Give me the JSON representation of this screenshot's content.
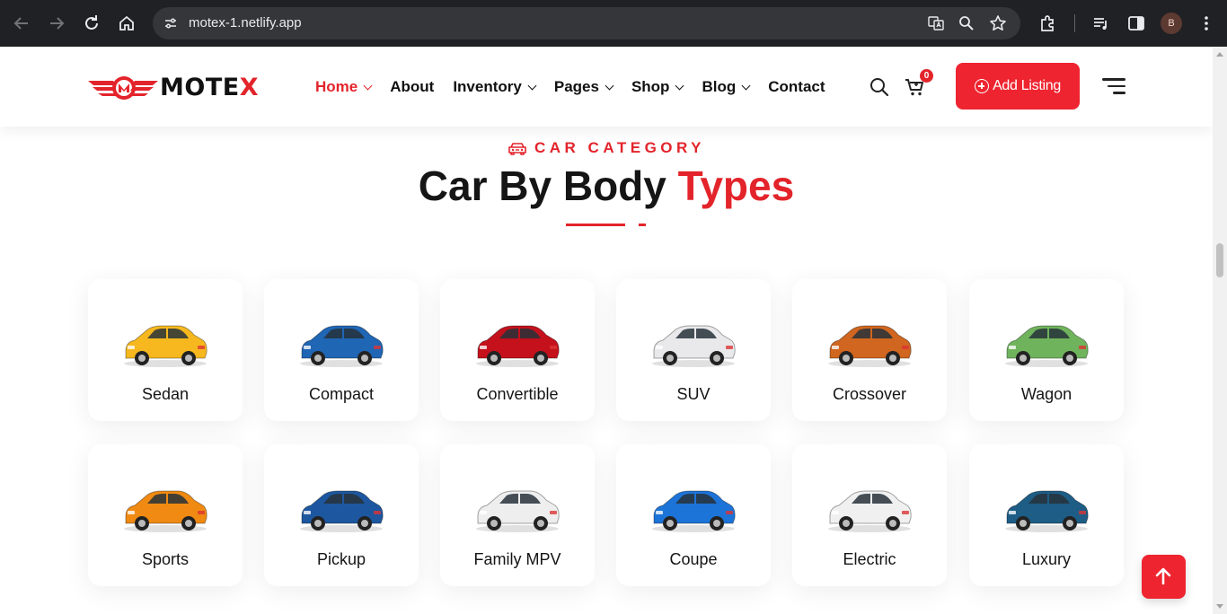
{
  "browser": {
    "url": "motex-1.netlify.app",
    "profile_initial": "B"
  },
  "site": {
    "logo_text": "MOTE",
    "logo_accent": "X",
    "nav": [
      {
        "label": "Home",
        "dropdown": true,
        "active": true
      },
      {
        "label": "About",
        "dropdown": false,
        "active": false
      },
      {
        "label": "Inventory",
        "dropdown": true,
        "active": false
      },
      {
        "label": "Pages",
        "dropdown": true,
        "active": false
      },
      {
        "label": "Shop",
        "dropdown": true,
        "active": false
      },
      {
        "label": "Blog",
        "dropdown": true,
        "active": false
      },
      {
        "label": "Contact",
        "dropdown": false,
        "active": false
      }
    ],
    "cart_count": "0",
    "add_listing_label": "Add Listing",
    "accent_color": "#e3242b"
  },
  "section": {
    "eyebrow": "CAR CATEGORY",
    "title_main": "Car By Body ",
    "title_accent": "Types"
  },
  "categories": [
    {
      "label": "Sedan",
      "icon": "yellow-sedan-car-image",
      "color": "#f6b81e"
    },
    {
      "label": "Compact",
      "icon": "blue-compact-suv-image",
      "color": "#1f66b5"
    },
    {
      "label": "Convertible",
      "icon": "red-convertible-car-image",
      "color": "#c4111c"
    },
    {
      "label": "SUV",
      "icon": "white-suv-image",
      "color": "#e9e9ec"
    },
    {
      "label": "Crossover",
      "icon": "orange-crossover-image",
      "color": "#d0661f"
    },
    {
      "label": "Wagon",
      "icon": "green-wagon-image",
      "color": "#6fb45c"
    },
    {
      "label": "Sports",
      "icon": "orange-sports-car-image",
      "color": "#f08a12"
    },
    {
      "label": "Pickup",
      "icon": "blue-pickup-truck-image",
      "color": "#1d57a0"
    },
    {
      "label": "Family MPV",
      "icon": "white-minivan-image",
      "color": "#eeeeee"
    },
    {
      "label": "Coupe",
      "icon": "blue-coupe-image",
      "color": "#1d74d8"
    },
    {
      "label": "Electric",
      "icon": "white-electric-car-image",
      "color": "#f0f0f0"
    },
    {
      "label": "Luxury",
      "icon": "blue-luxury-car-image",
      "color": "#1d5d86"
    }
  ]
}
